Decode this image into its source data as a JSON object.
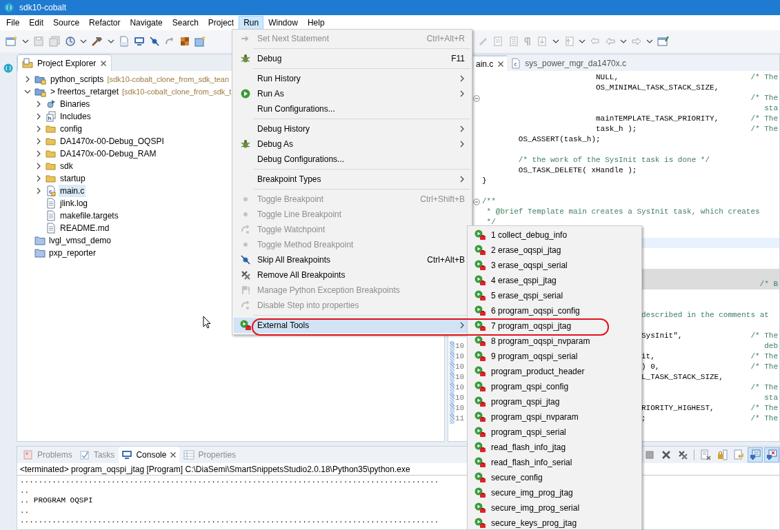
{
  "window": {
    "title": "sdk10-cobalt"
  },
  "menubar": [
    {
      "label": "File",
      "selected": false
    },
    {
      "label": "Edit",
      "selected": false
    },
    {
      "label": "Source",
      "selected": false
    },
    {
      "label": "Refactor",
      "selected": false
    },
    {
      "label": "Navigate",
      "selected": false
    },
    {
      "label": "Search",
      "selected": false
    },
    {
      "label": "Project",
      "selected": false
    },
    {
      "label": "Run",
      "selected": true
    },
    {
      "label": "Window",
      "selected": false
    },
    {
      "label": "Help",
      "selected": false
    }
  ],
  "project_explorer": {
    "title": "Project Explorer",
    "items": [
      {
        "name": "python_scripts",
        "detail": "[sdk10-cobalt_clone_from_sdk_tean",
        "kind": "project",
        "expanded": false,
        "selected": false
      },
      {
        "name": "> freertos_retarget",
        "detail": "[sdk10-cobalt_clone_from_sdk_t",
        "kind": "project",
        "expanded": true,
        "selected": false,
        "children": [
          {
            "name": "Binaries",
            "kind": "binaries",
            "expanded": false,
            "selected": false
          },
          {
            "name": "Includes",
            "kind": "includes",
            "expanded": false,
            "selected": false
          },
          {
            "name": "config",
            "kind": "folder",
            "expanded": false,
            "selected": false
          },
          {
            "name": "DA1470x-00-Debug_OQSPI",
            "kind": "folder",
            "expanded": false,
            "selected": false
          },
          {
            "name": "DA1470x-00-Debug_RAM",
            "kind": "folder",
            "expanded": false,
            "selected": false
          },
          {
            "name": "sdk",
            "kind": "folder",
            "expanded": false,
            "selected": false
          },
          {
            "name": "startup",
            "kind": "folder",
            "expanded": false,
            "selected": false
          },
          {
            "name": "main.c",
            "kind": "source",
            "expanded": false,
            "selected": true
          },
          {
            "name": "jlink.log",
            "kind": "file",
            "selected": false
          },
          {
            "name": "makefile.targets",
            "kind": "file",
            "selected": false
          },
          {
            "name": "README.md",
            "kind": "file",
            "selected": false
          }
        ]
      },
      {
        "name": "lvgl_vmsd_demo",
        "kind": "closed-project",
        "selected": false
      },
      {
        "name": "pxp_reporter",
        "kind": "closed-project",
        "selected": false
      }
    ]
  },
  "editor": {
    "tabs": [
      {
        "label": "ain.c",
        "selected": true
      },
      {
        "label": "sys_power_mgr_da1470x.c",
        "selected": false
      }
    ],
    "lines": [
      {
        "code": "NULL,",
        "comment": "/* The"
      },
      {
        "code": "OS_MINIMAL_TASK_STACK_SIZE,"
      },
      {
        "comment": "/* The",
        "collapsed": false
      },
      {
        "comment": "sta"
      },
      {
        "code": "mainTEMPLATE_TASK_PRIORITY,",
        "comment": "/* The"
      },
      {
        "code": "task_h );",
        "comment": "/* The"
      },
      {
        "code": "OS_ASSERT(task_h);"
      },
      {
        "comment": "/* the work of the SysInit task is done */"
      },
      {
        "code": "OS_TASK_DELETE( xHandle );"
      },
      {
        "code": "}"
      },
      {
        "comment": "/**",
        "collapsed": false
      },
      {
        "comment": "* @brief Template main creates a SysInit task, which creates"
      },
      {
        "comment": "*/"
      },
      {
        "current": true
      },
      {
        "shaded": true
      },
      {
        "comment": "/* B",
        "shaded": true
      },
      {
        "comment": "described in the comments at"
      },
      {
        "code": "SysInit\",",
        "comment": "/* The"
      },
      {
        "number": "10",
        "comment": "deb"
      },
      {
        "number": "10",
        "code": "it,",
        "comment": "/* The"
      },
      {
        "number": "10",
        "code": ") 0,",
        "comment": "/* The"
      },
      {
        "number": "10",
        "code": "L_TASK_STACK_SIZE,"
      },
      {
        "number": "10",
        "comment": "/* The"
      },
      {
        "number": "10",
        "comment": "sta"
      },
      {
        "number": "10",
        "code": "RIORITY_HIGHEST,",
        "comment": "/* The"
      },
      {
        "number": "11",
        "code": ";",
        "comment": "/* The"
      }
    ]
  },
  "run_menu": [
    {
      "kind": "item",
      "label": "Set Next Statement",
      "shortcut": "Ctrl+Alt+R",
      "disabled": true,
      "selected": false
    },
    {
      "kind": "separator"
    },
    {
      "kind": "item",
      "label": "Debug",
      "shortcut": "F11",
      "disabled": false,
      "selected": false
    },
    {
      "kind": "separator"
    },
    {
      "kind": "item",
      "label": "Run History",
      "submenu": true,
      "disabled": false,
      "selected": false
    },
    {
      "kind": "item",
      "label": "Run As",
      "submenu": true,
      "disabled": false,
      "selected": false
    },
    {
      "kind": "item",
      "label": "Run Configurations...",
      "disabled": false,
      "selected": false
    },
    {
      "kind": "separator"
    },
    {
      "kind": "item",
      "label": "Debug History",
      "submenu": true,
      "disabled": false,
      "selected": false
    },
    {
      "kind": "item",
      "label": "Debug As",
      "submenu": true,
      "disabled": false,
      "selected": false
    },
    {
      "kind": "item",
      "label": "Debug Configurations...",
      "disabled": false,
      "selected": false
    },
    {
      "kind": "separator"
    },
    {
      "kind": "item",
      "label": "Breakpoint Types",
      "submenu": true,
      "disabled": false,
      "selected": false
    },
    {
      "kind": "separator"
    },
    {
      "kind": "item",
      "label": "Toggle Breakpoint",
      "shortcut": "Ctrl+Shift+B",
      "disabled": true,
      "selected": false
    },
    {
      "kind": "item",
      "label": "Toggle Line Breakpoint",
      "disabled": true,
      "selected": false
    },
    {
      "kind": "item",
      "label": "Toggle Watchpoint",
      "disabled": true,
      "selected": false
    },
    {
      "kind": "item",
      "label": "Toggle Method Breakpoint",
      "disabled": true,
      "selected": false
    },
    {
      "kind": "item",
      "label": "Skip All Breakpoints",
      "shortcut": "Ctrl+Alt+B",
      "disabled": false,
      "selected": false
    },
    {
      "kind": "item",
      "label": "Remove All Breakpoints",
      "disabled": false,
      "selected": false
    },
    {
      "kind": "item",
      "label": "Manage Python Exception Breakpoints",
      "disabled": true,
      "selected": false
    },
    {
      "kind": "item",
      "label": "Disable Step into properties",
      "disabled": true,
      "selected": false
    },
    {
      "kind": "separator"
    },
    {
      "kind": "item",
      "label": "External Tools",
      "submenu": true,
      "disabled": false,
      "selected": true
    }
  ],
  "external_tools_menu": [
    {
      "label": "1 collect_debug_info"
    },
    {
      "label": "2 erase_oqspi_jtag"
    },
    {
      "label": "3 erase_oqspi_serial"
    },
    {
      "label": "4 erase_qspi_jtag"
    },
    {
      "label": "5 erase_qspi_serial"
    },
    {
      "label": "6 program_oqspi_config"
    },
    {
      "label": "7 program_oqspi_jtag"
    },
    {
      "label": "8 program_oqspi_nvparam"
    },
    {
      "label": "9 program_oqspi_serial"
    },
    {
      "label": "program_product_header"
    },
    {
      "label": "program_qspi_config"
    },
    {
      "label": "program_qspi_jtag"
    },
    {
      "label": "program_qspi_nvparam"
    },
    {
      "label": "program_qspi_serial"
    },
    {
      "label": "read_flash_info_jtag"
    },
    {
      "label": "read_flash_info_serial"
    },
    {
      "label": "secure_config"
    },
    {
      "label": "secure_img_prog_jtag"
    },
    {
      "label": "secure_img_prog_serial"
    },
    {
      "label": "secure_keys_prog_jtag"
    }
  ],
  "bottom_panel": {
    "tabs": [
      {
        "label": "Problems",
        "selected": false
      },
      {
        "label": "Tasks",
        "selected": false
      },
      {
        "label": "Console",
        "selected": true
      },
      {
        "label": "Properties",
        "selected": false
      }
    ],
    "toolbar": [
      {
        "kind": "terminate",
        "on": false
      },
      {
        "kind": "remove",
        "on": false
      },
      {
        "kind": "remove-all",
        "on": false
      },
      {
        "kind": "clear",
        "on": false
      },
      {
        "kind": "scroll-lock",
        "on": false
      },
      {
        "kind": "word-wrap",
        "on": false
      },
      {
        "kind": "pin",
        "on": true
      },
      {
        "kind": "show-on-output",
        "on": true
      }
    ],
    "description": "<terminated> program_oqspi_jtag [Program] C:\\DiaSemi\\SmartSnippetsStudio2.0.18\\Python35\\python.exe",
    "output": [
      "............................................................................................",
      "..",
      ".. PROGRAM OQSPI",
      "..",
      "............................................................................................"
    ]
  }
}
